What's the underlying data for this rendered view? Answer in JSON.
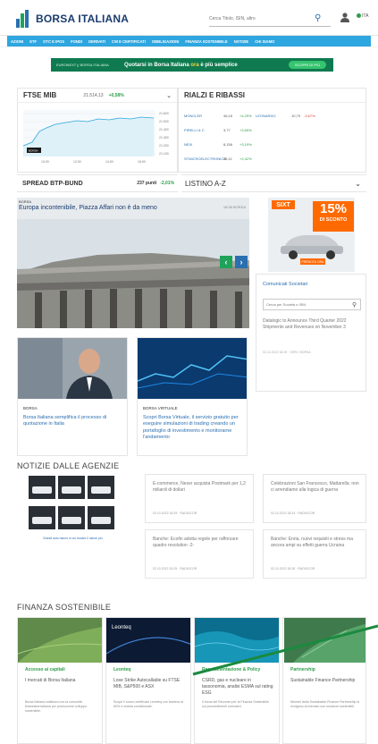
{
  "brand": {
    "name": "BORSA ITALIANA"
  },
  "search": {
    "placeholder": "Cerca Titolo, ISIN, altro"
  },
  "lang": "ITA",
  "nav": [
    "AZIONI",
    "ETF",
    "OTC E IPOS",
    "FONDI",
    "DERIVATI",
    "CW E CERTIFICATI",
    "OBBLIGAZIONI",
    "FINANZA SOSTENIBILE",
    "NOTIZIE",
    "CHI SIAMO"
  ],
  "banner": {
    "logos": "EURONEXT  ||  BORSA ITALIANA",
    "text_a": "Quotarsi in Borsa Italiana",
    "text_em": "ora",
    "text_b": "è più semplice",
    "button": "SCOPRI DI PIÙ"
  },
  "ftse": {
    "name": "FTSE MIB",
    "value": "21.514,13",
    "change": "+0,58%",
    "badge": "BORSA",
    "y_ticks": [
      "21.600",
      "21.500",
      "21.400",
      "21.300",
      "21.200",
      "21.100"
    ],
    "x_ticks": [
      "10:00",
      "12:00",
      "14:00",
      "16:00"
    ]
  },
  "rialzi": {
    "title": "RIALZI E RIBASSI",
    "rows": [
      {
        "name": "MONCLER",
        "price": "46,16",
        "chg": "+4,29%",
        "name2": "LEONARDO",
        "price2": "10,79",
        "chg2": "-3,67%"
      },
      {
        "name": "PIRELLI & C",
        "price": "3,77",
        "chg": "+3,65%",
        "name2": "",
        "price2": "",
        "chg2": ""
      },
      {
        "name": "NEXI",
        "price": "8,156",
        "chg": "+3,19%",
        "name2": "",
        "price2": "",
        "chg2": ""
      },
      {
        "name": "STMICROELECTRONICS",
        "price": "35,11",
        "chg": "+2,42%",
        "name2": "",
        "price2": "",
        "chg2": ""
      }
    ]
  },
  "spread": {
    "title": "SPREAD BTP-BUND",
    "points": "237 punti",
    "change": "-2,01%"
  },
  "listino": {
    "title": "LISTINO A-Z"
  },
  "hero": {
    "kicker": "BORSA",
    "title": "Europa incontenibile, Piazza Affari non è da meno",
    "tag": "18:36 BORSA"
  },
  "ad": {
    "brand": "SIXT",
    "percent": "15%",
    "label": "DI SCONTO",
    "cta": "PRENOTA ORA"
  },
  "comunicati": {
    "title": "Comunicati Societari",
    "placeholder": "Cerca per Società o ISIN",
    "text": "Datalogic to Announce Third Quarter 2022 Shipments and Revenues on November 3",
    "date": "02.10.2022 18:25 · SERV. BORSA"
  },
  "cards": [
    {
      "kicker": "BORSA",
      "title": "Borsa Italiana semplifica il processo di quotazione in Italia"
    },
    {
      "kicker": "BORSA VIRTUALE",
      "title": "Scopri Borsa Virtuale, il servizio gratuito per eseguire simulazioni di trading creando un portafoglio di investimento e monitorarne l'andamento"
    }
  ],
  "agency": {
    "title": "NOTIZIE DALLE AGENZIE",
    "thumb_caption": "Grandi auto hanno in cui trovare il valore più",
    "items": [
      {
        "title": "E-commerce, Nexer acquista Postmark per 1,2 miliardi di dollari",
        "date": "02.10.2022 18:29 · RADIOCOR"
      },
      {
        "title": "Celebrazioni San Francesco, Mattarella: non ci arrendiamo alla logica di guerra",
        "date": "02.10.2022 18:24 · RADIOCOR"
      },
      {
        "title": "Banche: Ecofin adotta regole per rafforzare quadro resolution -2-",
        "date": "02.10.2022 18:29 · RADIOCOR"
      },
      {
        "title": "Banche: Enria, nuovi requisiti e stress ma ancora ampi su effetti guerra Ucraina",
        "date": "02.10.2022 18:28 · RADIOCOR"
      }
    ]
  },
  "finanza": {
    "title": "FINANZA SOSTENIBILE",
    "cards": [
      {
        "kicker": "Accesso ai capitali",
        "title": "I mercati di Borsa Italiana",
        "snippet": "Borsa Italiana collabora con la comunità finanziaria italiana per promuovere sviluppo sostenibile."
      },
      {
        "kicker": "Leonteq",
        "title": "Lose Strike Autocallable su FTSE MIB, S&P500 e ASX",
        "snippet": "Scopri il nuovo certificato Leonteq con barriera al 60% e cedola condizionale."
      },
      {
        "kicker": "Regolamentazione & Policy",
        "title": "CSRD, gas e nucleare in tassonomia, analisi ESMA sul rating ESG",
        "snippet": "Il focus del Recomm per la Finanza Sostenibile sui provvedimenti normativi."
      },
      {
        "kicker": "Partnership",
        "title": "Sustainable Finance Partnership",
        "snippet": "Membri della Sustainable Finance Partnership si rivolgono al mercato con soluzioni sostenibili."
      }
    ]
  },
  "colors": {
    "brand_blue": "#2a6fb0",
    "nav_blue": "#2ea6df",
    "up_green": "#2e9e4a",
    "down_red": "#d43b3b",
    "accent_green": "#1ea35a"
  }
}
